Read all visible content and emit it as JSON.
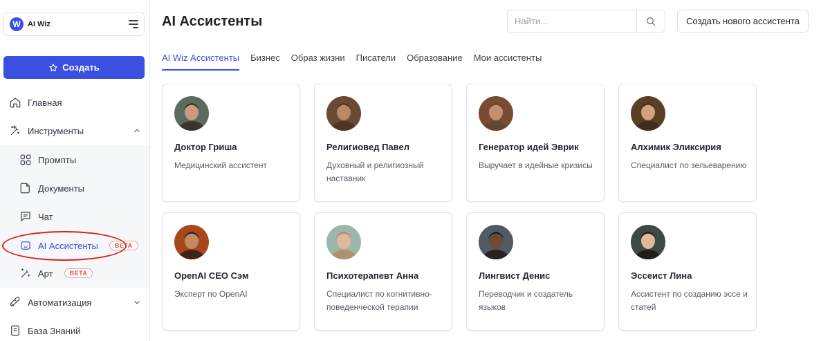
{
  "sidebar": {
    "logo_text": "AI Wiz",
    "create_label": "Создать",
    "nav": {
      "home": "Главная",
      "tools": "Инструменты",
      "prompts": "Промпты",
      "documents": "Документы",
      "chat": "Чат",
      "assistants": "AI Ассистенты",
      "assistants_badge": "BETA",
      "art": "Арт",
      "art_badge": "BETA",
      "automation": "Автоматизация",
      "knowledge": "База Знаний"
    }
  },
  "header": {
    "title": "AI Ассистенты",
    "search_placeholder": "Найти...",
    "new_assistant_label": "Создать нового ассистента"
  },
  "tabs": [
    {
      "label": "AI Wiz Ассистенты",
      "active": true
    },
    {
      "label": "Бизнес",
      "active": false
    },
    {
      "label": "Образ жизни",
      "active": false
    },
    {
      "label": "Писатели",
      "active": false
    },
    {
      "label": "Образование",
      "active": false
    },
    {
      "label": "Мои ассистенты",
      "active": false
    }
  ],
  "assistants": [
    {
      "name": "Доктор Гриша",
      "desc": "Медицинский ассистент",
      "avatar_bg": "#5a6b5f",
      "skin": "#c99a7c",
      "hair": "#3a2a22"
    },
    {
      "name": "Религиовед Павел",
      "desc": "Духовный и религиозный наставник",
      "avatar_bg": "#6b4a33",
      "skin": "#b98865",
      "hair": "#4a3222"
    },
    {
      "name": "Генератор идей Эврик",
      "desc": "Выручает в идейные кризисы",
      "avatar_bg": "#7a4b32",
      "skin": "#c48f6f",
      "hair": "#5b4636"
    },
    {
      "name": "Алхимик Эликсирия",
      "desc": "Специалист по зельеварению",
      "avatar_bg": "#5b3f24",
      "skin": "#d1a27e",
      "hair": "#3d2a1d"
    },
    {
      "name": "OpenAI CEO Сэм",
      "desc": "Эксперт по OpenAI",
      "avatar_bg": "#a8461c",
      "skin": "#c48a62",
      "hair": "#2c1e16"
    },
    {
      "name": "Психотерапевт Анна",
      "desc": "Специалист по когнитивно-поведенческой терапии",
      "avatar_bg": "#9bb7ad",
      "skin": "#e0b99a",
      "hair": "#b58963"
    },
    {
      "name": "Лингвист Денис",
      "desc": "Переводчик и создатель языков",
      "avatar_bg": "#4f5a63",
      "skin": "#6e4a36",
      "hair": "#1f1a17"
    },
    {
      "name": "Эссеист Лина",
      "desc": "Ассистент по созданию эссе и статей",
      "avatar_bg": "#3d4a43",
      "skin": "#e2b896",
      "hair": "#1c1612"
    }
  ]
}
